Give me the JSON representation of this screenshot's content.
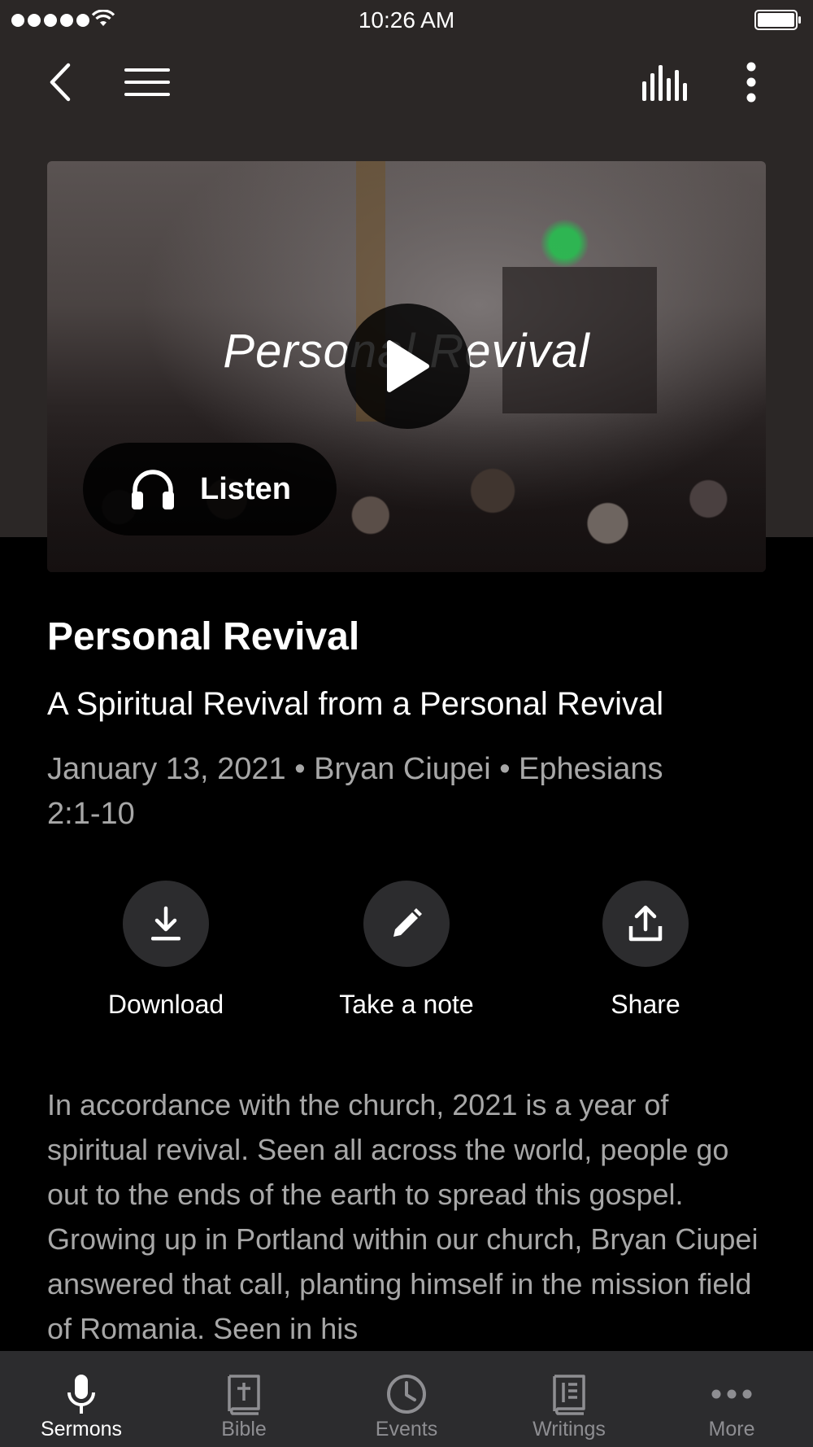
{
  "status_bar": {
    "time": "10:26 AM"
  },
  "hero": {
    "overlay_title": "Personal Revival",
    "listen_label": "Listen"
  },
  "sermon": {
    "title": "Personal Revival",
    "subtitle": "A Spiritual Revival from a Personal Revival",
    "meta": "January 13, 2021 • Bryan Ciupei • Ephesians 2:1-10",
    "description": "In accordance with the church, 2021 is a year of spiritual revival. Seen all across the world, people go out to the ends of the earth to spread this gospel. Growing up in Portland within our church, Bryan Ciupei answered that call, planting himself in the mission field of Romania. Seen in his"
  },
  "actions": [
    {
      "label": "Download",
      "icon": "download-icon"
    },
    {
      "label": "Take a note",
      "icon": "pencil-icon"
    },
    {
      "label": "Share",
      "icon": "share-icon"
    }
  ],
  "tabs": [
    {
      "label": "Sermons",
      "icon": "microphone-icon",
      "active": true
    },
    {
      "label": "Bible",
      "icon": "bible-icon",
      "active": false
    },
    {
      "label": "Events",
      "icon": "clock-icon",
      "active": false
    },
    {
      "label": "Writings",
      "icon": "book-icon",
      "active": false
    },
    {
      "label": "More",
      "icon": "ellipsis-icon",
      "active": false
    }
  ],
  "colors": {
    "background": "#000000",
    "top_band": "#2b2726",
    "secondary_text": "#a7a7a7",
    "tab_bar": "#2c2c2e",
    "inactive_tab": "#8e8e92"
  }
}
